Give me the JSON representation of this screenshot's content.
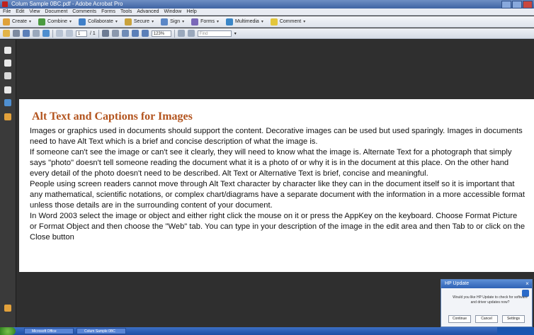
{
  "window": {
    "title": "Colum Sample 0BC.pdf - Adobe Acrobat Pro"
  },
  "menu": [
    "File",
    "Edit",
    "View",
    "Document",
    "Comments",
    "Forms",
    "Tools",
    "Advanced",
    "Window",
    "Help"
  ],
  "task_toolbar": [
    {
      "label": "Create",
      "icon": "create-icon",
      "color": "#e0a23a"
    },
    {
      "label": "Combine",
      "icon": "combine-icon",
      "color": "#4a9a3f"
    },
    {
      "label": "Collaborate",
      "icon": "collaborate-icon",
      "color": "#3f7fc8"
    },
    {
      "label": "Secure",
      "icon": "lock-icon",
      "color": "#c9a23c"
    },
    {
      "label": "Sign",
      "icon": "pen-icon",
      "color": "#5b87c6"
    },
    {
      "label": "Forms",
      "icon": "forms-icon",
      "color": "#7a68b8"
    },
    {
      "label": "Multimedia",
      "icon": "multimedia-icon",
      "color": "#3a86c7"
    },
    {
      "label": "Comment",
      "icon": "comment-icon",
      "color": "#e3c63b"
    }
  ],
  "nav_toolbar": {
    "page_current": "1",
    "page_total": "/ 1",
    "zoom": "123%",
    "find_placeholder": "Find"
  },
  "document": {
    "heading": "Alt Text and Captions for Images",
    "paragraphs": [
      "Images or graphics used in documents should support the content. Decorative images can be used but used sparingly. Images in documents need to have Alt Text which is a brief and concise description of what the image is.",
      "If someone can't see the image or can't see it clearly, they will need to know what the image is. Alternate Text for a photograph that simply says \"photo\" doesn't tell someone reading the document what it is a photo of or why it is in the document at this place. On the other hand every detail of the photo doesn't need to be described. Alt Text or Alternative Text is brief, concise and meaningful.",
      "People using screen readers cannot move through Alt Text character by character like they can in the document itself so it is important that any mathematical, scientific notations, or complex chart/diagrams have a separate document with the information in a more accessible format unless those details are in the surrounding content of your document.",
      "In Word 2003 select the image or object and either right click the mouse on it or press the AppKey on the keyboard. Choose Format Picture or Format Object and then choose the \"Web\" tab. You can type in your description of the image in the edit area and then Tab to or click on the Close button"
    ]
  },
  "dialog": {
    "title": "HP Update",
    "message": "Would you like HP Update to check for software and driver updates now?",
    "buttons": [
      "Continue",
      "Cancel",
      "Settings"
    ]
  },
  "taskbar": {
    "items": [
      "Microsoft Office",
      "Colum Sample 0BC"
    ]
  },
  "colors": {
    "heading": "#b3541e",
    "titlebar": "#3f64a3",
    "doc_background": "#2f2f2f"
  }
}
